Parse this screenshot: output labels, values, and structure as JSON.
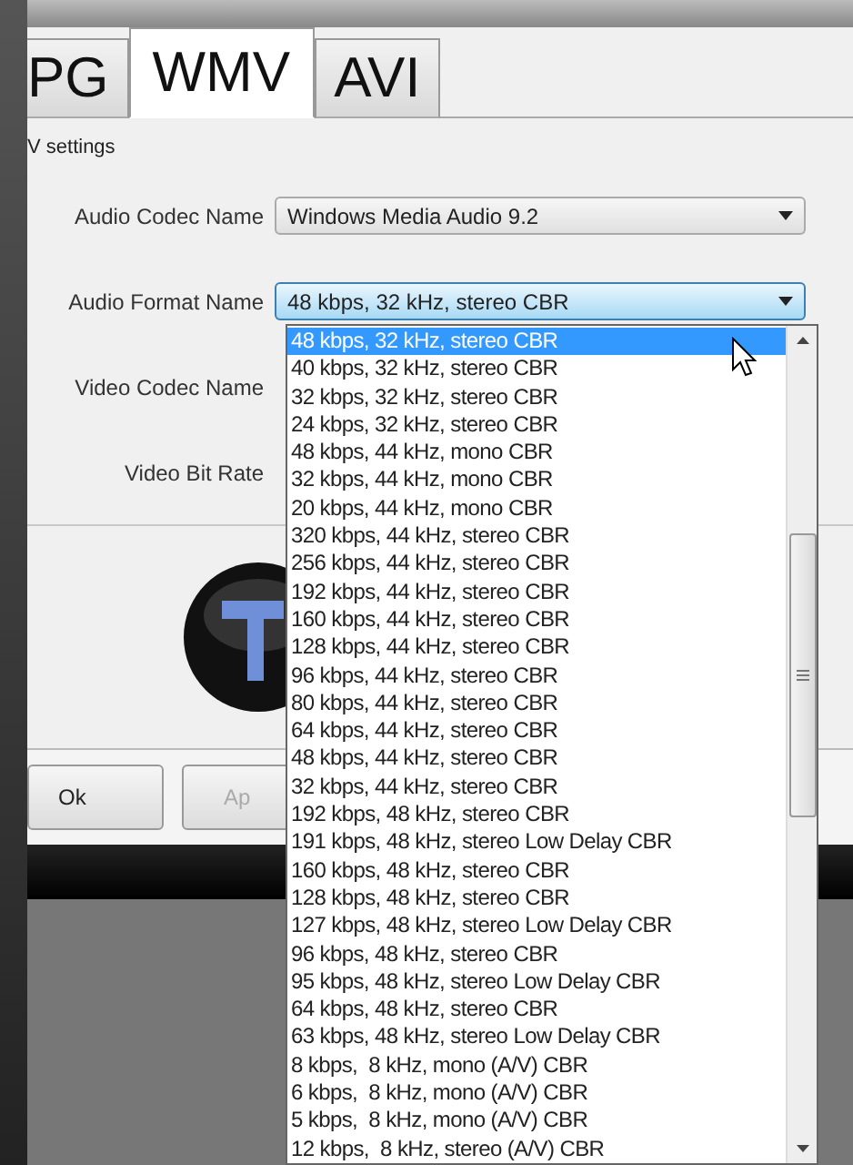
{
  "tabs": [
    {
      "label": "PG",
      "selected": false
    },
    {
      "label": "WMV",
      "selected": true
    },
    {
      "label": "AVI",
      "selected": false
    }
  ],
  "group": {
    "title": "V settings",
    "fields": [
      {
        "label": "Audio Codec Name",
        "value": "Windows Media Audio 9.2",
        "focused": false
      },
      {
        "label": "Audio Format Name",
        "value": "48 kbps, 32 kHz, stereo CBR",
        "focused": true
      },
      {
        "label": "Video Codec Name"
      },
      {
        "label": "Video Bit Rate"
      }
    ]
  },
  "buttons": [
    {
      "label": "Ok",
      "disabled": false
    },
    {
      "label": "Ap",
      "disabled": true
    }
  ],
  "dropdown": {
    "options": [
      {
        "label": "48 kbps, 32 kHz, stereo CBR",
        "selected": true
      },
      {
        "label": "40 kbps, 32 kHz, stereo CBR",
        "selected": false
      },
      {
        "label": "32 kbps, 32 kHz, stereo CBR",
        "selected": false
      },
      {
        "label": "24 kbps, 32 kHz, stereo CBR",
        "selected": false
      },
      {
        "label": "48 kbps, 44 kHz, mono CBR",
        "selected": false
      },
      {
        "label": "32 kbps, 44 kHz, mono CBR",
        "selected": false
      },
      {
        "label": "20 kbps, 44 kHz, mono CBR",
        "selected": false
      },
      {
        "label": "320 kbps, 44 kHz, stereo CBR",
        "selected": false
      },
      {
        "label": "256 kbps, 44 kHz, stereo CBR",
        "selected": false
      },
      {
        "label": "192 kbps, 44 kHz, stereo CBR",
        "selected": false
      },
      {
        "label": "160 kbps, 44 kHz, stereo CBR",
        "selected": false
      },
      {
        "label": "128 kbps, 44 kHz, stereo CBR",
        "selected": false
      },
      {
        "label": "96 kbps, 44 kHz, stereo CBR",
        "selected": false
      },
      {
        "label": "80 kbps, 44 kHz, stereo CBR",
        "selected": false
      },
      {
        "label": "64 kbps, 44 kHz, stereo CBR",
        "selected": false
      },
      {
        "label": "48 kbps, 44 kHz, stereo CBR",
        "selected": false
      },
      {
        "label": "32 kbps, 44 kHz, stereo CBR",
        "selected": false
      },
      {
        "label": "192 kbps, 48 kHz, stereo CBR",
        "selected": false
      },
      {
        "label": "191 kbps, 48 kHz, stereo Low Delay CBR",
        "selected": false
      },
      {
        "label": "160 kbps, 48 kHz, stereo CBR",
        "selected": false
      },
      {
        "label": "128 kbps, 48 kHz, stereo CBR",
        "selected": false
      },
      {
        "label": "127 kbps, 48 kHz, stereo Low Delay CBR",
        "selected": false
      },
      {
        "label": "96 kbps, 48 kHz, stereo CBR",
        "selected": false
      },
      {
        "label": "95 kbps, 48 kHz, stereo Low Delay CBR",
        "selected": false
      },
      {
        "label": "64 kbps, 48 kHz, stereo CBR",
        "selected": false
      },
      {
        "label": "63 kbps, 48 kHz, stereo Low Delay CBR",
        "selected": false
      },
      {
        "label": "8 kbps,  8 kHz, mono (A/V) CBR",
        "selected": false
      },
      {
        "label": "6 kbps,  8 kHz, mono (A/V) CBR",
        "selected": false
      },
      {
        "label": "5 kbps,  8 kHz, mono (A/V) CBR",
        "selected": false
      },
      {
        "label": "12 kbps,  8 kHz, stereo (A/V) CBR",
        "selected": false
      }
    ]
  }
}
